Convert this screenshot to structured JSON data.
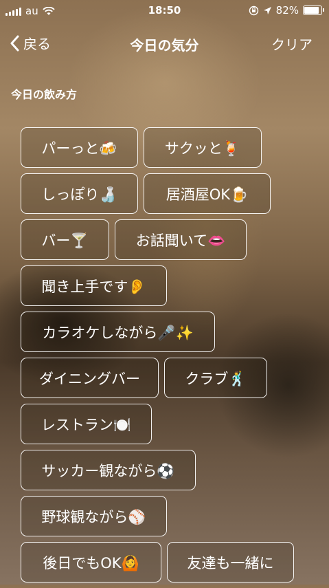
{
  "status_bar": {
    "carrier": "au",
    "time": "18:50",
    "battery": "82%",
    "battery_level": 0.82
  },
  "nav": {
    "back_label": "戻る",
    "title": "今日の気分",
    "clear_label": "クリア"
  },
  "section_label": "今日の飲み方",
  "options": [
    "パーっと🍻",
    "サクッと🍹",
    "しっぽり🍶",
    "居酒屋OK🍺",
    "バー🍸",
    "お話聞いて👄",
    "聞き上手です👂",
    "カラオケしながら🎤✨",
    "ダイニングバー",
    "クラブ🕺",
    "レストラン🍽️",
    "サッカー観ながら⚽",
    "野球観ながら⚾",
    "後日でもOK🙆",
    "友達も一緒に"
  ]
}
